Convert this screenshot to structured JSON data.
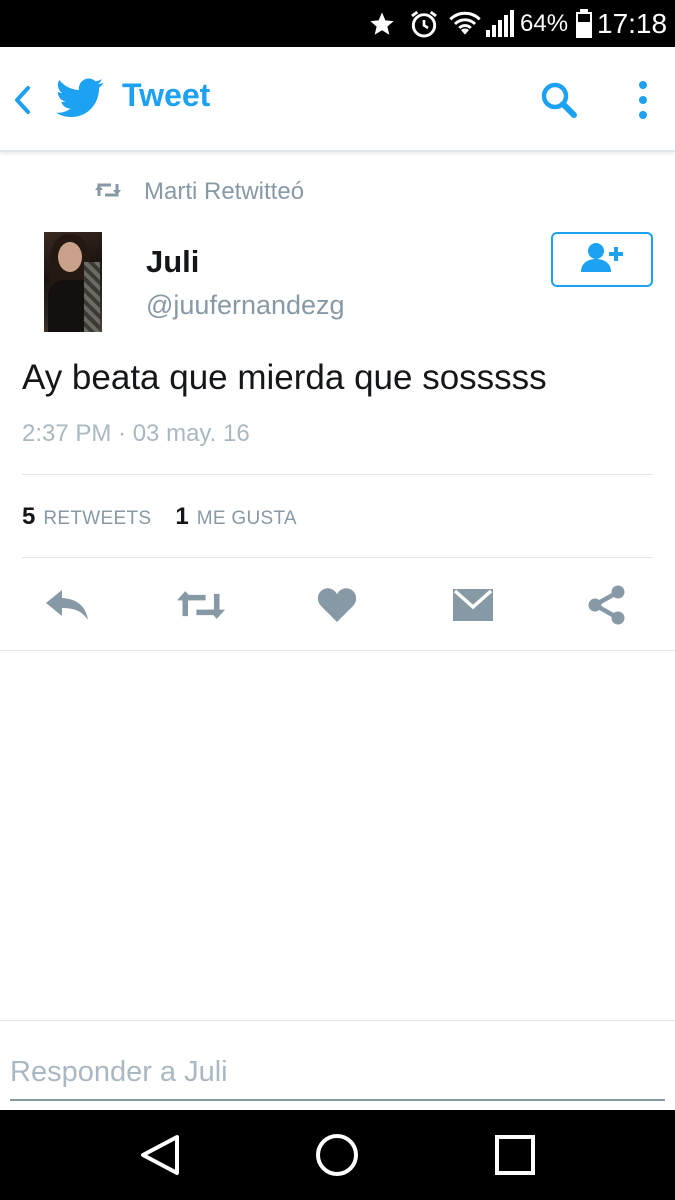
{
  "status_bar": {
    "battery_percent": "64%",
    "time": "17:18",
    "icons": [
      "star-icon",
      "alarm-icon",
      "wifi-icon",
      "signal-icon",
      "battery-icon"
    ]
  },
  "app_bar": {
    "title": "Tweet",
    "icons": [
      "back-icon",
      "twitter-bird-icon",
      "search-icon",
      "overflow-menu-icon"
    ]
  },
  "tweet": {
    "retweeted_by": "Marti Retwitteó",
    "author_name": "Juli",
    "author_handle": "@juufernandezg",
    "text": "Ay beata que mierda que sosssss",
    "timestamp": "2:37 PM · 03 may. 16",
    "retweets_count": "5",
    "retweets_label": "RETWEETS",
    "likes_count": "1",
    "likes_label": "ME GUSTA"
  },
  "actions": [
    "reply-icon",
    "retweet-icon",
    "like-icon",
    "direct-message-icon",
    "share-icon"
  ],
  "reply": {
    "placeholder": "Responder a Juli"
  },
  "nav_bar": {
    "icons": [
      "back-triangle-icon",
      "home-circle-icon",
      "recents-square-icon"
    ]
  },
  "colors": {
    "accent": "#1da1f2",
    "muted": "#8899a6",
    "text": "#14171a"
  }
}
